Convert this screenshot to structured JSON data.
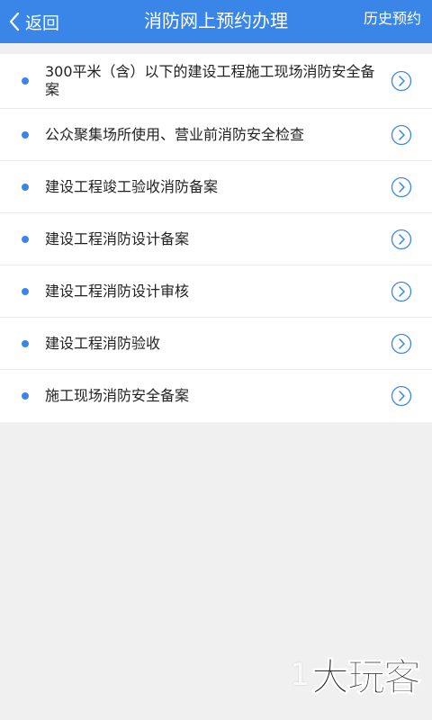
{
  "header": {
    "back_label": "返回",
    "title": "消防网上预约办理",
    "history_label": "历史预约",
    "bg_color": "#3a86e8"
  },
  "list": {
    "items": [
      {
        "label": "300平米（含）以下的建设工程施工现场消防安全备案",
        "icon": "chevron-right-circle-icon"
      },
      {
        "label": "公众聚集场所使用、营业前消防安全检查",
        "icon": "chevron-right-circle-icon"
      },
      {
        "label": "建设工程竣工验收消防备案",
        "icon": "chevron-right-circle-icon"
      },
      {
        "label": "建设工程消防设计备案",
        "icon": "chevron-right-circle-icon"
      },
      {
        "label": "建设工程消防设计审核",
        "icon": "chevron-right-circle-icon"
      },
      {
        "label": "建设工程消防验收",
        "icon": "chevron-right-circle-icon"
      },
      {
        "label": "施工现场消防安全备案",
        "icon": "chevron-right-circle-icon"
      }
    ],
    "bullet_color": "#3a86e8"
  },
  "watermark": {
    "digits": "1",
    "text": "大玩客"
  }
}
